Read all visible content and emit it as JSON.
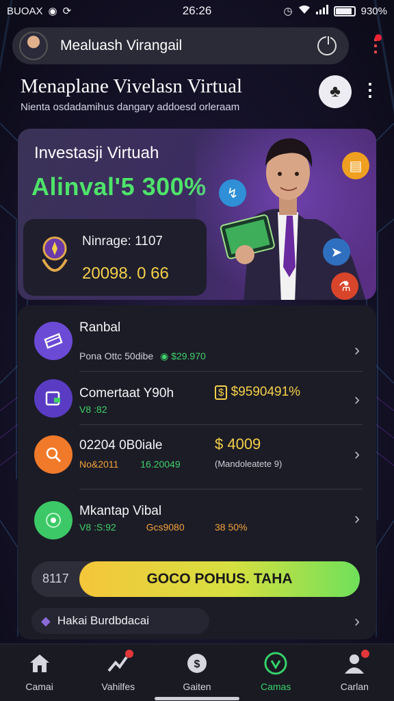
{
  "status_bar": {
    "left_text": "BUOAX",
    "time": "26:26",
    "battery_text": "930%"
  },
  "account": {
    "name": "Mealuash Virangail"
  },
  "header": {
    "title": "Menaplane Vivelasn Virtual",
    "subtitle": "Nienta osdadamihus dangary addoesd orleraam"
  },
  "hero": {
    "title": "Investasji Virtuah",
    "value": "Alinval'5 300%",
    "inner_label": "Ninrage: 1107",
    "inner_value": "20098. 0 66"
  },
  "rows": [
    {
      "title": "Ranbal",
      "sub": "Pona Ottc 50dibe",
      "sub_value": "$29.970",
      "icon": "card-icon",
      "icon_color": "#6b4ad6"
    },
    {
      "title": "Comertaat Y90h",
      "sub": "V8 :82",
      "value": "$9590491%",
      "icon": "wallet-icon",
      "icon_color": "#5a3cc4"
    },
    {
      "title": "02204 0B0iale",
      "sub": "No&2011",
      "sub_value": "16.20049",
      "value": "$ 4009",
      "value_note": "(Mandoleatete 9)",
      "icon": "search-icon",
      "icon_color": "#f07a2a"
    },
    {
      "title": "Mkantap Vibal",
      "sub": "V8 :S:92",
      "sub_value": "Gcs9080",
      "value": "38 50%",
      "icon": "radar-icon",
      "icon_color": "#3cc866"
    }
  ],
  "cta": {
    "left_label": "8117",
    "button_label": "GOCO POHUS. TAHA"
  },
  "footer_row": {
    "label": "Hakai Burdbdacai"
  },
  "nav": [
    {
      "label": "Camai",
      "icon": "home-icon"
    },
    {
      "label": "Vahilfes",
      "icon": "chart-icon",
      "badge": true
    },
    {
      "label": "Gaiten",
      "icon": "coin-icon"
    },
    {
      "label": "Camas",
      "icon": "growth-icon",
      "active": true
    },
    {
      "label": "Carlan",
      "icon": "profile-icon",
      "badge": true
    }
  ]
}
